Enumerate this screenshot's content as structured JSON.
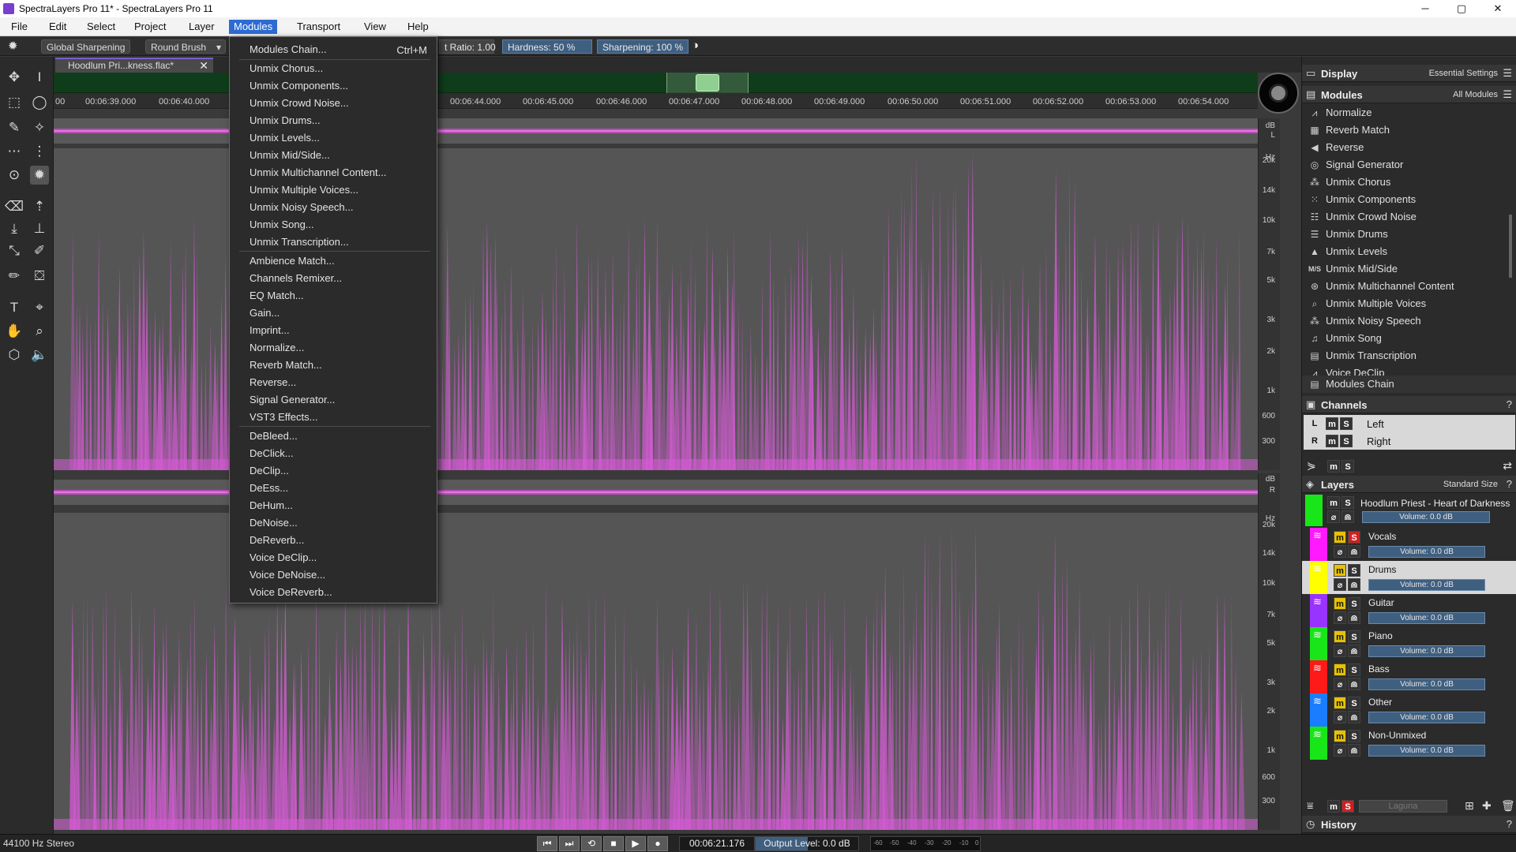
{
  "window": {
    "title": "SpectraLayers Pro 11* - SpectraLayers Pro 11",
    "minimize": "─",
    "maximize": "▢",
    "close": "✕"
  },
  "menubar": [
    "File",
    "Edit",
    "Select",
    "Project",
    "Layer",
    "Modules",
    "Transport",
    "View",
    "Help"
  ],
  "toolbar": {
    "mode": "Global Sharpening",
    "brush": "Round Brush",
    "ratio": "t Ratio: 1.00",
    "hardness": "Hardness: 50 %",
    "sharpening": "Sharpening: 100 %"
  },
  "document": {
    "tab": "Hoodlum Pri...kness.flac*",
    "close": "✕"
  },
  "ruler": {
    "ticks": [
      "00",
      "00:06:39.000",
      "00:06:40.000",
      "00:06:44.000",
      "00:06:45.000",
      "00:06:46.000",
      "00:06:47.000",
      "00:06:48.000",
      "00:06:49.000",
      "00:06:50.000",
      "00:06:51.000",
      "00:06:52.000",
      "00:06:53.000",
      "00:06:54.000"
    ]
  },
  "scale": {
    "db": "dB",
    "hz": "Hz",
    "left_channel": "L",
    "right_channel": "R",
    "freqs": [
      "20k",
      "14k",
      "10k",
      "7k",
      "5k",
      "3k",
      "2k",
      "1k",
      "600",
      "300"
    ],
    "minus_inf": "-∞"
  },
  "modules_menu": {
    "chain": "Modules Chain...",
    "shortcut": "Ctrl+M",
    "group1": [
      "Unmix Chorus...",
      "Unmix Components...",
      "Unmix Crowd Noise...",
      "Unmix Drums...",
      "Unmix Levels...",
      "Unmix Mid/Side...",
      "Unmix Multichannel Content...",
      "Unmix Multiple Voices...",
      "Unmix Noisy Speech...",
      "Unmix Song...",
      "Unmix Transcription..."
    ],
    "group2": [
      "Ambience Match...",
      "Channels Remixer...",
      "EQ Match...",
      "Gain...",
      "Imprint...",
      "Normalize...",
      "Reverb Match...",
      "Reverse...",
      "Signal Generator...",
      "VST3 Effects..."
    ],
    "group3": [
      "DeBleed...",
      "DeClick...",
      "DeClip...",
      "DeEss...",
      "DeHum...",
      "DeNoise...",
      "DeReverb...",
      "Voice DeClip...",
      "Voice DeNoise...",
      "Voice DeReverb..."
    ]
  },
  "panels": {
    "display": {
      "title": "Display",
      "preset": "Essential Settings"
    },
    "modules": {
      "title": "Modules",
      "filter": "All Modules",
      "items": [
        "Normalize",
        "Reverb Match",
        "Reverse",
        "Signal Generator",
        "Unmix Chorus",
        "Unmix Components",
        "Unmix Crowd Noise",
        "Unmix Drums",
        "Unmix Levels",
        "Unmix Mid/Side",
        "Unmix Multichannel Content",
        "Unmix Multiple Voices",
        "Unmix Noisy Speech",
        "Unmix Song",
        "Unmix Transcription",
        "Voice DeClip"
      ],
      "chain": "Modules Chain"
    },
    "channels": {
      "title": "Channels",
      "help": "?",
      "items": [
        {
          "tag": "L",
          "name": "Left"
        },
        {
          "tag": "R",
          "name": "Right"
        }
      ]
    },
    "layers": {
      "title": "Layers",
      "size": "Standard Size",
      "help": "?",
      "project": {
        "name": "Hoodlum Priest - Heart of Darkness",
        "volume": "Volume: 0.0 dB"
      },
      "items": [
        {
          "name": "Vocals",
          "color": "#ff19ff",
          "volume": "Volume: 0.0 dB"
        },
        {
          "name": "Drums",
          "color": "#ffff00",
          "volume": "Volume: 0.0 dB"
        },
        {
          "name": "Guitar",
          "color": "#9933ff",
          "volume": "Volume: 0.0 dB"
        },
        {
          "name": "Piano",
          "color": "#19e619",
          "volume": "Volume: 0.0 dB"
        },
        {
          "name": "Bass",
          "color": "#ff1a1a",
          "volume": "Volume: 0.0 dB"
        },
        {
          "name": "Other",
          "color": "#1a7dff",
          "volume": "Volume: 0.0 dB"
        },
        {
          "name": "Non-Unmixed",
          "color": "#19e619",
          "volume": "Volume: 0.0 dB"
        }
      ],
      "blend": "Laguna"
    },
    "history": {
      "title": "History",
      "help": "?"
    }
  },
  "mute": "m",
  "solo": "S",
  "status": {
    "format": "44100 Hz Stereo",
    "time": "00:06:21.176",
    "output": "Output Level: 0.0 dB",
    "meter": [
      "-60",
      "-50",
      "-40",
      "-30",
      "-20",
      "-10",
      "0"
    ]
  },
  "colors": {
    "accent": "#2d6bd2",
    "spectrum": "#d65bd6",
    "overview": "#0f3d1b"
  }
}
